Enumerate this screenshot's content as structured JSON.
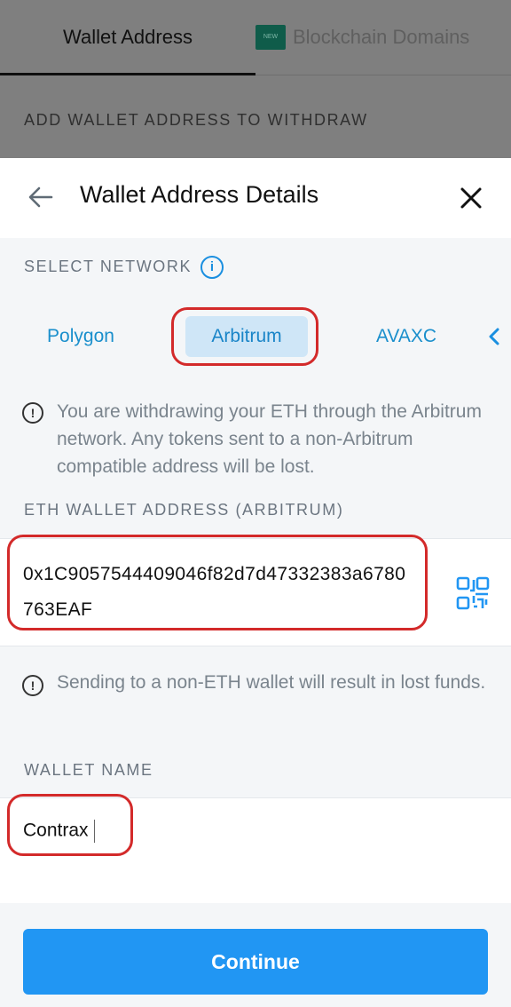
{
  "background": {
    "tabs": [
      {
        "label": "Wallet Address",
        "active": true
      },
      {
        "label": "Blockchain Domains",
        "badge": "NEW",
        "active": false
      }
    ],
    "section_title": "ADD WALLET ADDRESS TO WITHDRAW"
  },
  "sheet": {
    "title": "Wallet Address Details",
    "select_network_label": "SELECT NETWORK",
    "networks": [
      {
        "label": "Polygon",
        "selected": false
      },
      {
        "label": "Arbitrum",
        "selected": true
      },
      {
        "label": "AVAXC",
        "selected": false
      }
    ],
    "network_notice": "You are withdrawing your ETH through the Arbitrum network. Any tokens sent to a non-Arbitrum compatible address will be lost.",
    "address_label": "ETH WALLET ADDRESS (ARBITRUM)",
    "address_value": "0x1C9057544409046f82d7d47332383a6780763EAF",
    "address_notice": "Sending to a non-ETH wallet will result in lost funds.",
    "wallet_name_label": "WALLET NAME",
    "wallet_name_value": "Contrax",
    "continue_label": "Continue"
  },
  "icons": [
    "back-arrow-icon",
    "close-icon",
    "info-icon",
    "warning-icon",
    "qr-code-icon",
    "chevron-left-icon"
  ],
  "colors": {
    "accent": "#2196f3",
    "selected_network_bg": "#cfe6f7",
    "highlight": "#d32a2a",
    "overlay": "#7f7f7f"
  }
}
